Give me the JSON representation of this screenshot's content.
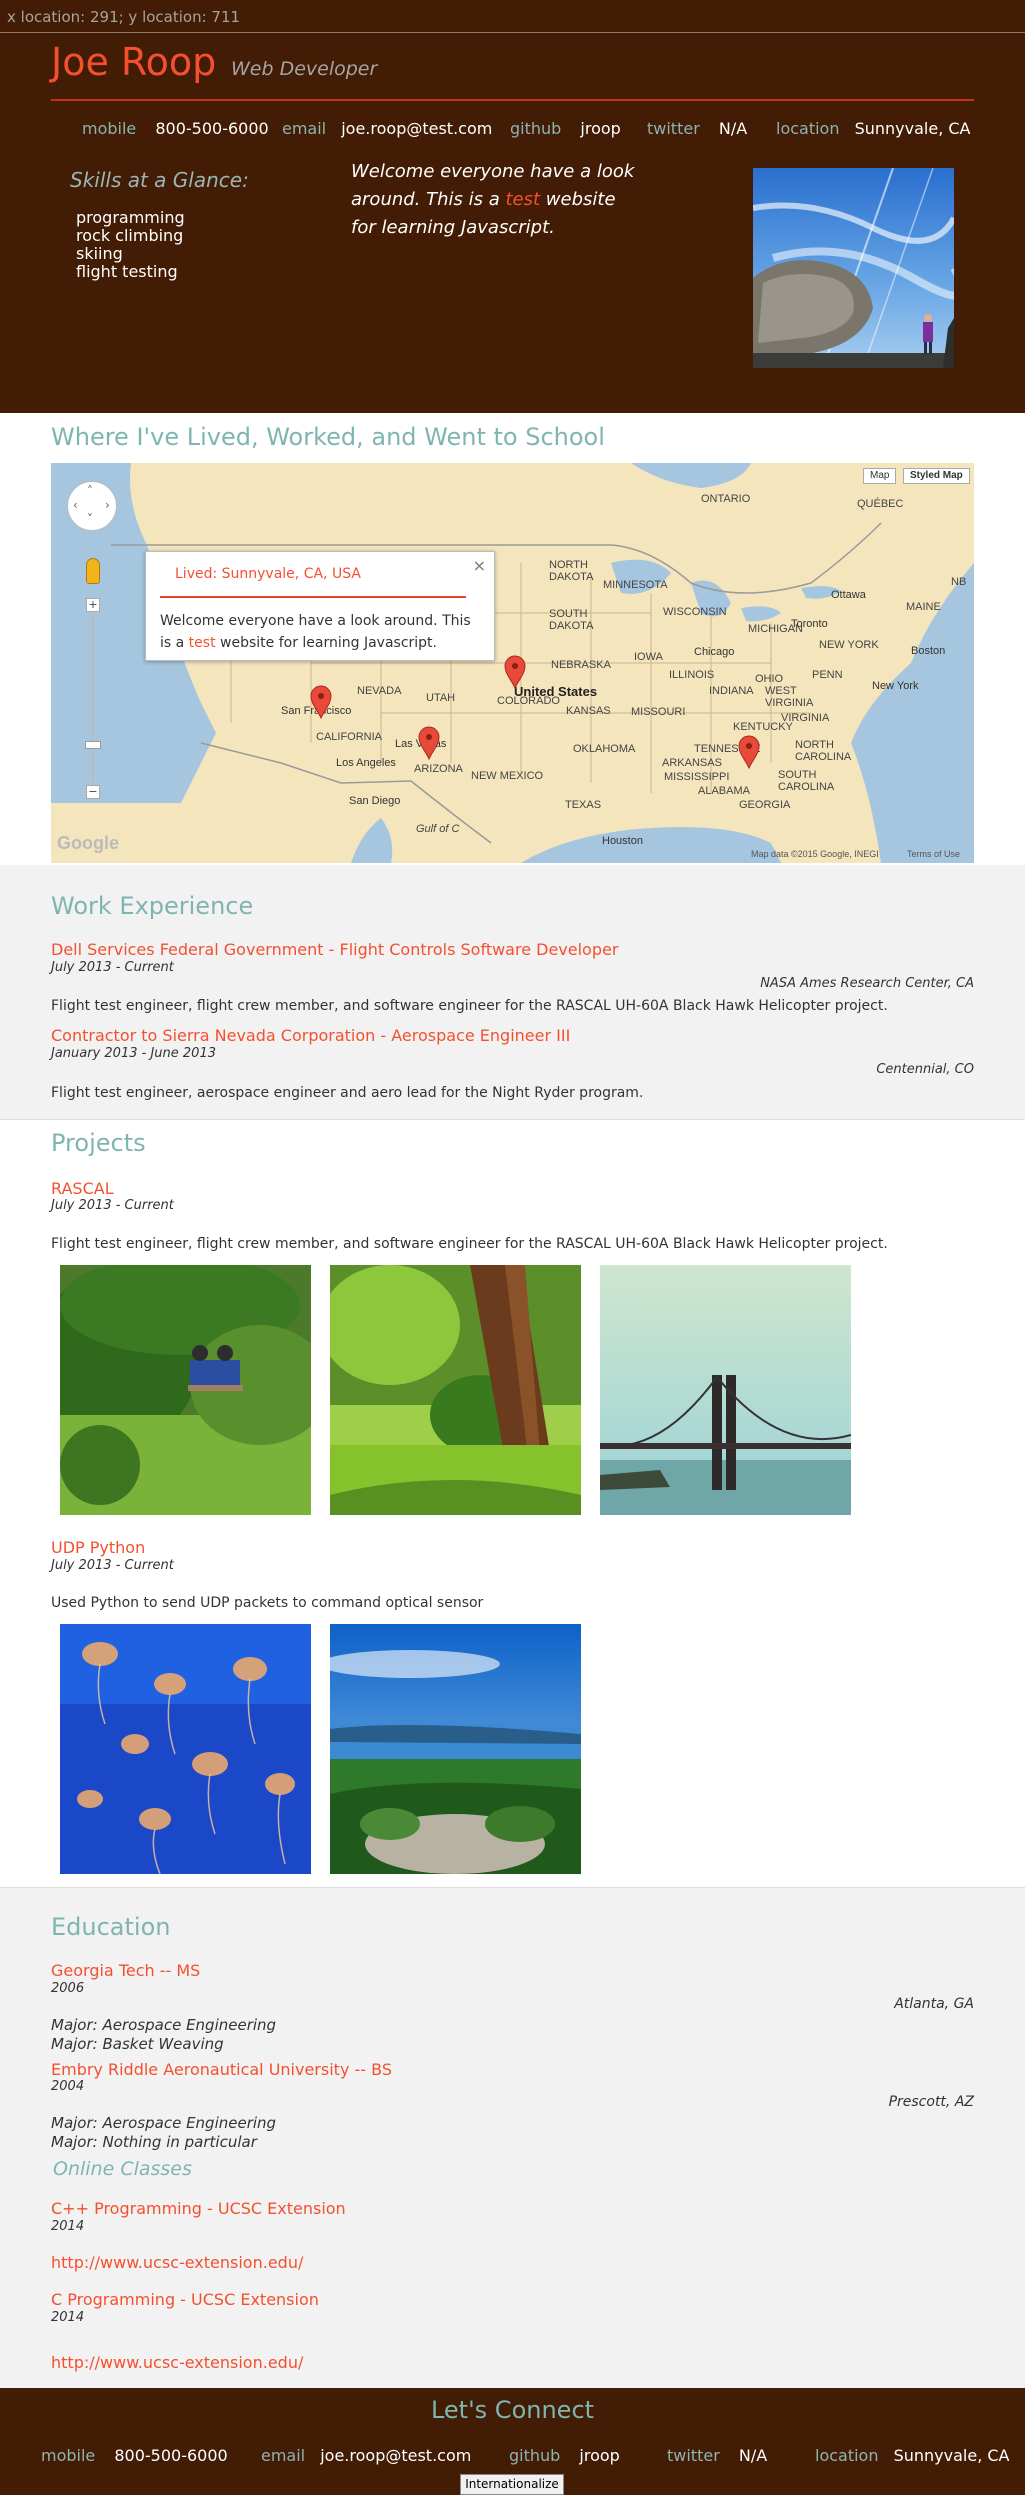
{
  "coord_readout": "x location: 291; y location: 711",
  "header": {
    "name": "Joe Roop",
    "role": "Web Developer",
    "contacts": [
      {
        "label": "mobile",
        "value": "800-500-6000"
      },
      {
        "label": "email",
        "value": "joe.roop@test.com"
      },
      {
        "label": "github",
        "value": "jroop"
      },
      {
        "label": "twitter",
        "value": "N/A"
      },
      {
        "label": "location",
        "value": "Sunnyvale, CA"
      }
    ],
    "skills_title": "Skills at a Glance:",
    "skills": [
      "programming",
      "rock climbing",
      "skiing",
      "flight testing"
    ],
    "welcome_pre": "Welcome everyone have a look around. This is a ",
    "welcome_highlight": "test",
    "welcome_post": " website for learning Javascript."
  },
  "map_section": {
    "title": "Where I've Lived, Worked, and Went to School",
    "buttons": [
      "Map",
      "Styled Map"
    ],
    "infowindow": {
      "title": "Lived: Sunnyvale, CA, USA",
      "close": "×",
      "body_pre": "Welcome everyone have a look around. This is a ",
      "body_highlight": "test",
      "body_post": " website for learning Javascript."
    },
    "labels": {
      "ontario": "ONTARIO",
      "quebec": "QUÉBEC",
      "north_dakota": "NORTH\nDAKOTA",
      "minnesota": "MINNESOTA",
      "south_dakota": "SOUTH\nDAKOTA",
      "wisconsin": "WISCONSIN",
      "michigan": "MICHIGAN",
      "nebraska": "NEBRASKA",
      "iowa": "IOWA",
      "nevada": "NEVADA",
      "utah": "UTAH",
      "colorado": "COLORADO",
      "united_states": "United States",
      "kansas": "KANSAS",
      "missouri": "MISSOURI",
      "illinois": "ILLINOIS",
      "indiana": "INDIANA",
      "ohio": "OHIO",
      "penn": "PENN",
      "new_york_state": "NEW YORK",
      "california": "CALIFORNIA",
      "arizona": "ARIZONA",
      "oklahoma": "OKLAHOMA",
      "new_mexico": "NEW MEXICO",
      "arkansas": "ARKANSAS",
      "tennessee": "TENNESSEE",
      "mississippi": "MISSISSIPPI",
      "alabama": "ALABAMA",
      "georgia": "GEORGIA",
      "texas": "TEXAS",
      "kentucky": "KENTUCKY",
      "west_virginia": "WEST\nVIRGINIA",
      "virginia": "VIRGINIA",
      "north_carolina": "NORTH\nCAROLINA",
      "south_carolina": "SOUTH\nCAROLINA",
      "maine": "MAINE",
      "nb": "NB",
      "gulf": "Gulf of C"
    },
    "cities": {
      "ottawa": "Ottawa",
      "toronto": "Toronto",
      "boston": "Boston",
      "chicago": "Chicago",
      "new_york": "New York",
      "san_francisco": "San Francisco",
      "las_vegas": "Las Vegas",
      "los_angeles": "Los Angeles",
      "san_diego": "San Diego",
      "houston": "Houston"
    },
    "google_logo": "Google",
    "attribution": "Map data ©2015 Google, INEGI",
    "terms": "Terms of Use",
    "zoom_in": "+",
    "zoom_out": "−"
  },
  "work": {
    "title": "Work Experience",
    "jobs": [
      {
        "title": "Dell Services Federal Government - Flight Controls Software Developer",
        "dates": "July 2013 - Current",
        "location": "NASA Ames Research Center, CA",
        "description": "Flight test engineer, flight crew member, and software engineer for the RASCAL UH-60A Black Hawk Helicopter project."
      },
      {
        "title": "Contractor to Sierra Nevada Corporation - Aerospace Engineer III",
        "dates": "January 2013 - June 2013",
        "location": "Centennial, CO",
        "description": "Flight test engineer, aerospace engineer and aero lead for the Night Ryder program."
      }
    ]
  },
  "projects": {
    "title": "Projects",
    "items": [
      {
        "title": "RASCAL",
        "dates": "July 2013 - Current",
        "description": "Flight test engineer, flight crew member, and software engineer for the RASCAL UH-60A Black Hawk Helicopter project."
      },
      {
        "title": "UDP Python",
        "dates": "July 2013 - Current",
        "description": "Used Python to send UDP packets to command optical sensor"
      }
    ]
  },
  "education": {
    "title": "Education",
    "schools": [
      {
        "name": "Georgia Tech -- MS",
        "date": "2006",
        "location": "Atlanta, GA",
        "majors": [
          "Major: Aerospace Engineering",
          "Major: Basket Weaving"
        ]
      },
      {
        "name": "Embry Riddle Aeronautical University -- BS",
        "date": "2004",
        "location": "Prescott, AZ",
        "majors": [
          "Major: Aerospace Engineering",
          "Major: Nothing in particular"
        ]
      }
    ],
    "online_title": "Online Classes",
    "online": [
      {
        "title": "C++ Programming - UCSC Extension",
        "date": "2014",
        "url": "http://www.ucsc-extension.edu/"
      },
      {
        "title": "C Programming - UCSC Extension",
        "date": "2014",
        "url": "http://www.ucsc-extension.edu/"
      }
    ]
  },
  "footer": {
    "title": "Let's Connect",
    "contacts": [
      {
        "label": "mobile",
        "value": "800-500-6000"
      },
      {
        "label": "email",
        "value": "joe.roop@test.com"
      },
      {
        "label": "github",
        "value": "jroop"
      },
      {
        "label": "twitter",
        "value": "N/A"
      },
      {
        "label": "location",
        "value": "Sunnyvale, CA"
      }
    ],
    "intl_button": "Internationalize"
  }
}
